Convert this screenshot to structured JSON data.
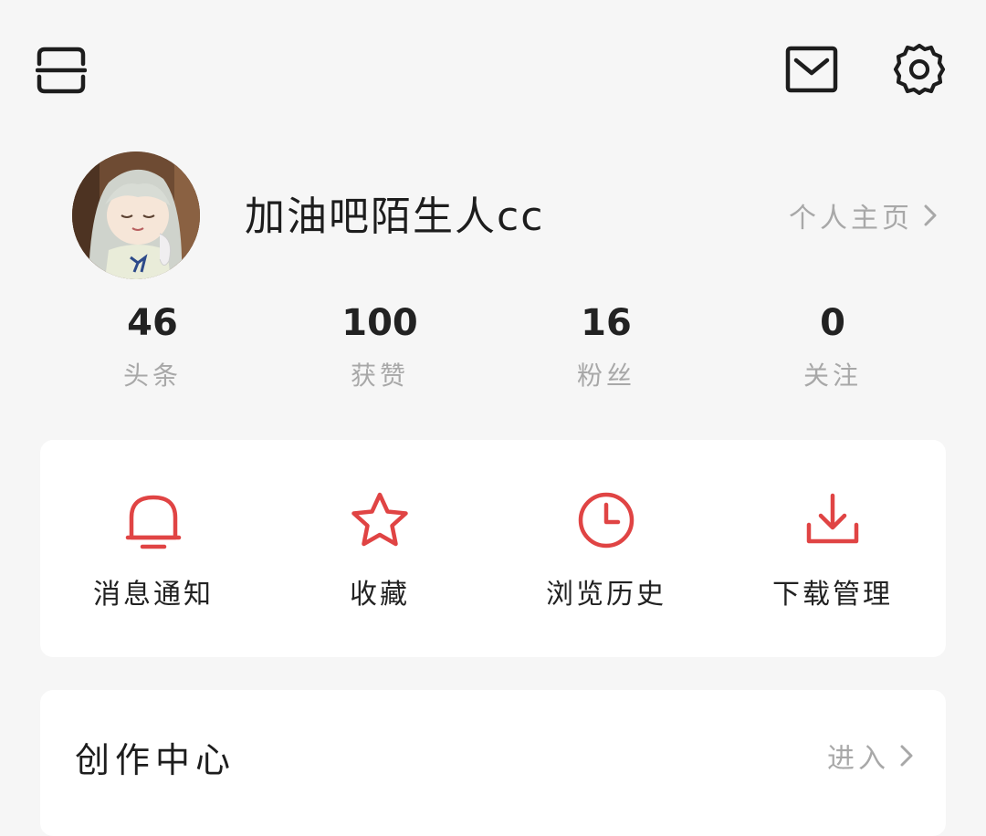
{
  "header": {
    "scan_icon": "scan-icon",
    "mail_icon": "mail-icon",
    "settings_icon": "gear-icon"
  },
  "profile": {
    "username": "加油吧陌生人cc",
    "homepage_link": "个人主页"
  },
  "stats": [
    {
      "value": "46",
      "label": "头条"
    },
    {
      "value": "100",
      "label": "获赞"
    },
    {
      "value": "16",
      "label": "粉丝"
    },
    {
      "value": "0",
      "label": "关注"
    }
  ],
  "quick_actions": [
    {
      "label": "消息通知",
      "icon": "bell-icon"
    },
    {
      "label": "收藏",
      "icon": "star-icon"
    },
    {
      "label": "浏览历史",
      "icon": "clock-icon"
    },
    {
      "label": "下载管理",
      "icon": "download-icon"
    }
  ],
  "creator_center": {
    "title": "创作中心",
    "enter_link": "进入"
  },
  "colors": {
    "accent": "#e04444",
    "background": "#f6f6f6",
    "card": "#ffffff",
    "muted_text": "#a8a8a8"
  }
}
